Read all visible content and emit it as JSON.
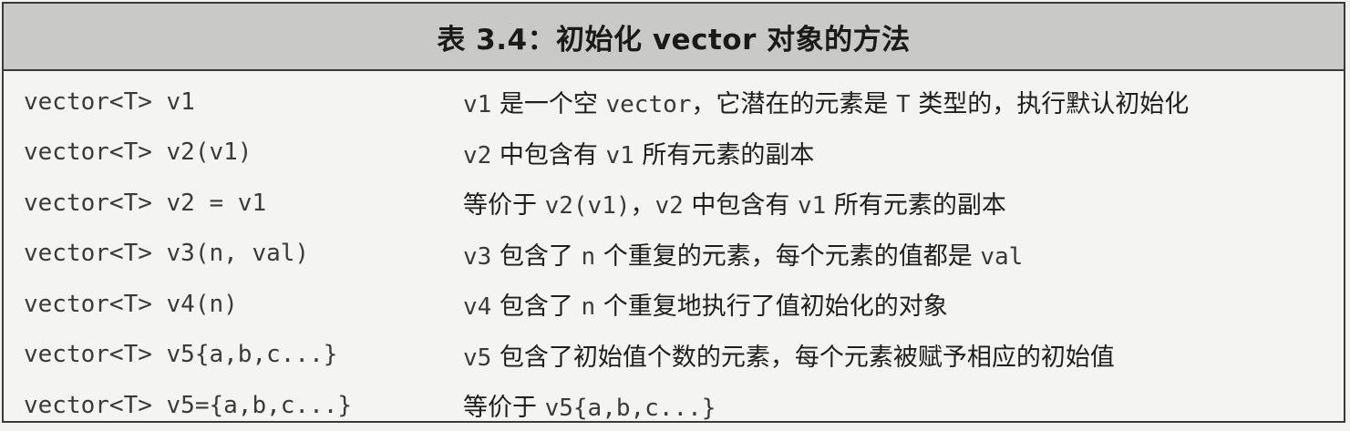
{
  "caption": "表 3.4：初始化 vector 对象的方法",
  "rows": [
    {
      "code": "vector<T> v1",
      "desc": [
        {
          "t": "v1",
          "mono": true
        },
        {
          "t": " 是一个空 ",
          "mono": false
        },
        {
          "t": "vector",
          "mono": true
        },
        {
          "t": "，它潜在的元素是 ",
          "mono": false
        },
        {
          "t": "T",
          "mono": true
        },
        {
          "t": " 类型的，执行默认初始化",
          "mono": false
        }
      ]
    },
    {
      "code": "vector<T> v2(v1)",
      "desc": [
        {
          "t": "v2",
          "mono": true
        },
        {
          "t": " 中包含有 ",
          "mono": false
        },
        {
          "t": "v1",
          "mono": true
        },
        {
          "t": " 所有元素的副本",
          "mono": false
        }
      ]
    },
    {
      "code": "vector<T> v2 = v1",
      "desc": [
        {
          "t": "等价于 ",
          "mono": false
        },
        {
          "t": "v2(v1)",
          "mono": true
        },
        {
          "t": "，",
          "mono": false
        },
        {
          "t": "v2",
          "mono": true
        },
        {
          "t": " 中包含有 ",
          "mono": false
        },
        {
          "t": "v1",
          "mono": true
        },
        {
          "t": " 所有元素的副本",
          "mono": false
        }
      ]
    },
    {
      "code": "vector<T> v3(n, val)",
      "desc": [
        {
          "t": "v3",
          "mono": true
        },
        {
          "t": " 包含了 ",
          "mono": false
        },
        {
          "t": "n",
          "mono": true
        },
        {
          "t": " 个重复的元素，每个元素的值都是 ",
          "mono": false
        },
        {
          "t": "val",
          "mono": true
        }
      ]
    },
    {
      "code": "vector<T> v4(n)",
      "desc": [
        {
          "t": "v4",
          "mono": true
        },
        {
          "t": " 包含了 ",
          "mono": false
        },
        {
          "t": "n",
          "mono": true
        },
        {
          "t": " 个重复地执行了值初始化的对象",
          "mono": false
        }
      ]
    },
    {
      "code": "vector<T> v5{a,b,c...}",
      "desc": [
        {
          "t": "v5",
          "mono": true
        },
        {
          "t": " 包含了初始值个数的元素，每个元素被赋予相应的初始值",
          "mono": false
        }
      ]
    },
    {
      "code": "vector<T> v5={a,b,c...}",
      "desc": [
        {
          "t": "等价于 ",
          "mono": false
        },
        {
          "t": "v5{a,b,c...}",
          "mono": true
        }
      ]
    }
  ]
}
